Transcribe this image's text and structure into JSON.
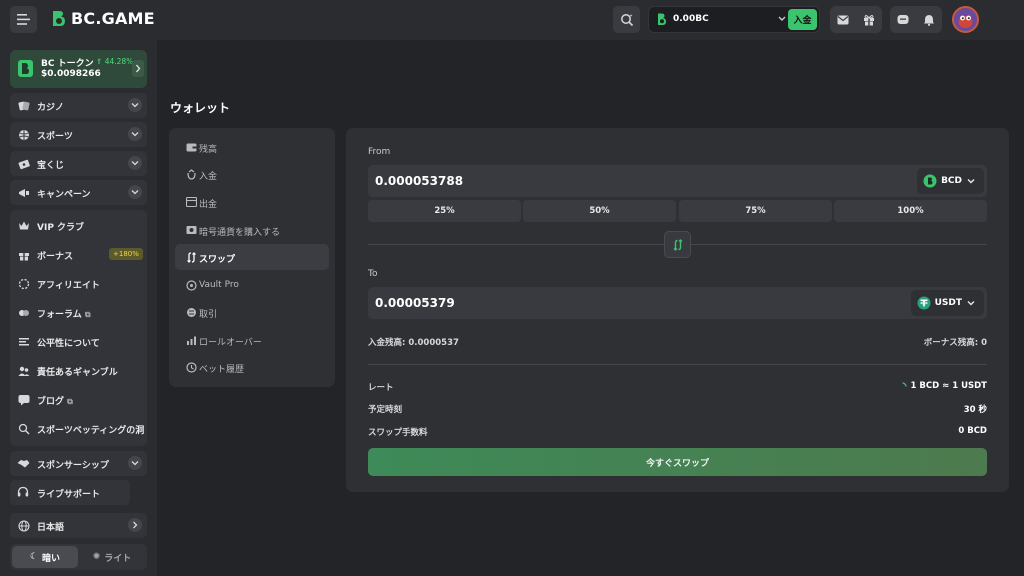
{
  "header": {
    "logo_text": "BC.GAME",
    "wallet_balance": "0.00BC",
    "deposit_label": "入金",
    "accent_color": "#3bc46e"
  },
  "sidebar": {
    "token": {
      "name": "BC トークン",
      "change": "44.28%",
      "price": "$0.0098266"
    },
    "sections": [
      {
        "label": "カジノ",
        "icon": "casino-icon"
      },
      {
        "label": "スポーツ",
        "icon": "sports-icon"
      },
      {
        "label": "宝くじ",
        "icon": "lottery-icon"
      },
      {
        "label": "キャンペーン",
        "icon": "campaign-icon"
      }
    ],
    "menu": [
      {
        "label": "VIP クラブ",
        "icon": "crown-icon"
      },
      {
        "label": "ボーナス",
        "icon": "gift-icon",
        "badge": "+180%"
      },
      {
        "label": "アフィリエイト",
        "icon": "affiliate-icon"
      },
      {
        "label": "フォーラム",
        "icon": "forum-icon",
        "external": true
      },
      {
        "label": "公平性について",
        "icon": "fairness-icon"
      },
      {
        "label": "責任あるギャンブル",
        "icon": "responsible-icon"
      },
      {
        "label": "ブログ",
        "icon": "blog-icon",
        "external": true
      },
      {
        "label": "スポーツベッティングの洞",
        "icon": "insight-icon"
      }
    ],
    "sponsorship": "スポンサーシップ",
    "live_support": "ライブサポート",
    "language": "日本語",
    "theme_dark": "暗い",
    "theme_light": "ライト"
  },
  "page": {
    "title": "ウォレット"
  },
  "wallet_menu": [
    {
      "label": "残高",
      "icon": "wallet-icon"
    },
    {
      "label": "入金",
      "icon": "deposit-icon"
    },
    {
      "label": "出金",
      "icon": "withdraw-icon"
    },
    {
      "label": "暗号通貨を購入する",
      "icon": "buy-crypto-icon"
    },
    {
      "label": "スワップ",
      "icon": "swap-icon",
      "active": true
    },
    {
      "label": "Vault Pro",
      "icon": "vault-icon"
    },
    {
      "label": "取引",
      "icon": "transactions-icon"
    },
    {
      "label": "ロールオーバー",
      "icon": "rollover-icon"
    },
    {
      "label": "ベット履歴",
      "icon": "history-icon"
    }
  ],
  "swap": {
    "from_label": "From",
    "from_amount": "0.000053788",
    "from_currency": "BCD",
    "percent_buttons": [
      "25%",
      "50%",
      "75%",
      "100%"
    ],
    "to_label": "To",
    "to_amount": "0.00005379",
    "to_currency": "USDT",
    "deposit_balance": "入金残高: 0.0000537",
    "bonus_balance": "ボーナス残高: 0",
    "rate_label": "レート",
    "rate_value": "1 BCD ≈ 1 USDT",
    "eta_label": "予定時刻",
    "eta_value": "30 秒",
    "fee_label": "スワップ手数料",
    "fee_value": "0 BCD",
    "submit_label": "今すぐスワップ"
  }
}
